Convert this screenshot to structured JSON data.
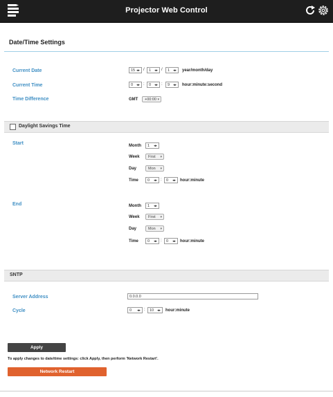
{
  "header": {
    "title": "Projector Web Control"
  },
  "page": {
    "title": "Date/Time Settings"
  },
  "date_time": {
    "current_date_label": "Current Date",
    "date_year": "15",
    "date_month": "1",
    "date_day": "1",
    "date_sep": "/",
    "date_format": "year/month/day",
    "current_time_label": "Current Time",
    "time_hour": "0",
    "time_minute": "0",
    "time_second": "9",
    "time_sep": ":",
    "time_format": "hour:minute:second",
    "time_difference_label": "Time Difference",
    "gmt_label": "GMT",
    "gmt_offset": "+00:00"
  },
  "dst": {
    "label": "Daylight Savings Time",
    "enabled": false,
    "start_label": "Start",
    "end_label": "End",
    "month_label": "Month",
    "week_label": "Week",
    "day_label": "Day",
    "time_label": "Time",
    "time_sep": ":",
    "time_format": "hour:minute",
    "start": {
      "month": "1",
      "week": "First",
      "day": "Mon",
      "hour": "0",
      "minute": "0"
    },
    "end": {
      "month": "1",
      "week": "First",
      "day": "Mon",
      "hour": "0",
      "minute": "0"
    }
  },
  "sntp": {
    "section_label": "SNTP",
    "server_address_label": "Server Address",
    "server_address_value": "0.0.0.0",
    "cycle_label": "Cycle",
    "cycle_hour": "0",
    "cycle_minute": "10",
    "cycle_sep": ":",
    "cycle_format": "hour:minute"
  },
  "actions": {
    "apply_label": "Apply",
    "note": "To apply changes to date/time settings: click Apply, then perform 'Network Restart'.",
    "network_restart_label": "Network Restart"
  },
  "arrow_glyph": "◂▸",
  "icons": {
    "menu": "menu-icon",
    "refresh": "refresh-icon",
    "settings": "gear-icon"
  },
  "colors": {
    "topbar": "#1e1e1e",
    "label_blue": "#3f8fc4",
    "restart_button": "#e0622e",
    "apply_button": "#444444"
  }
}
